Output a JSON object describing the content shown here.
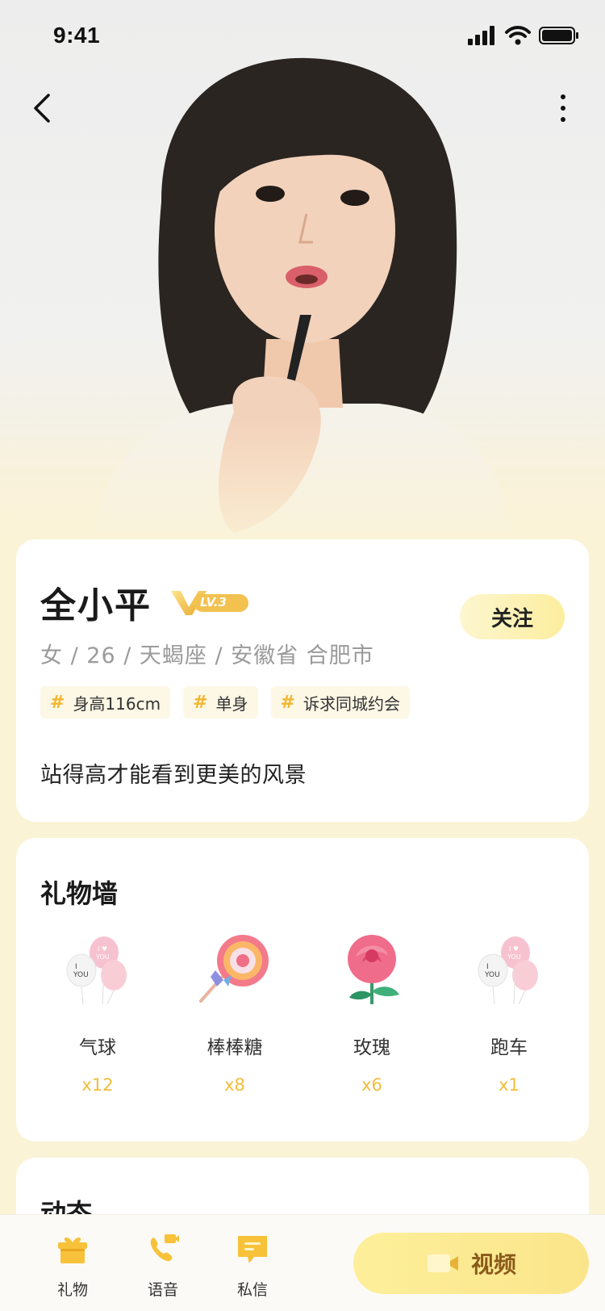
{
  "status_bar": {
    "time": "9:41"
  },
  "profile": {
    "name": "全小平",
    "vip_level": "LV.3",
    "follow_label": "关注",
    "info": "女 / 26 / 天蝎座 / 安徽省 合肥市",
    "tags": [
      {
        "hash": "#",
        "text": "身高116cm"
      },
      {
        "hash": "#",
        "text": "单身"
      },
      {
        "hash": "#",
        "text": "诉求同城约会"
      }
    ],
    "bio": "站得高才能看到更美的风景"
  },
  "gift_wall": {
    "title": "礼物墙",
    "items": [
      {
        "name": "气球",
        "count": "x12",
        "icon": "balloon-icon"
      },
      {
        "name": "棒棒糖",
        "count": "x8",
        "icon": "lollipop-icon"
      },
      {
        "name": "玫瑰",
        "count": "x6",
        "icon": "rose-icon"
      },
      {
        "name": "跑车",
        "count": "x1",
        "icon": "balloon-icon"
      }
    ]
  },
  "moments": {
    "title": "动态"
  },
  "bottom_bar": {
    "tabs": [
      {
        "label": "礼物",
        "icon": "gift-icon"
      },
      {
        "label": "语音",
        "icon": "phone-icon"
      },
      {
        "label": "私信",
        "icon": "message-icon"
      }
    ],
    "video_label": "视频"
  },
  "colors": {
    "accent": "#f2bd3a",
    "page_bg": "#fbf3d6",
    "button_yellow": "#fce98f",
    "video_text": "#8a5a1a"
  }
}
